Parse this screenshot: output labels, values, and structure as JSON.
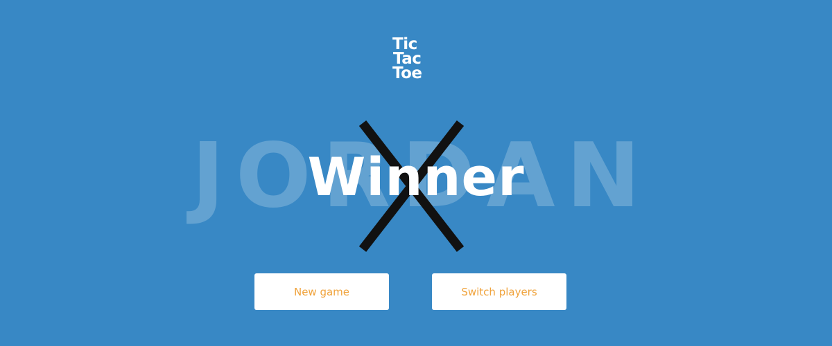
{
  "logo": {
    "line1": "Tic",
    "line2": "Tac",
    "line3": "Toe"
  },
  "result": {
    "player_name": "JORDAN",
    "title": "Winner",
    "symbol": "X",
    "symbol_color": "#111111"
  },
  "buttons": {
    "new_game": "New game",
    "switch_players": "Switch players"
  },
  "colors": {
    "background": "#3888c5",
    "button_text": "#f0a33c",
    "button_bg": "#ffffff"
  }
}
